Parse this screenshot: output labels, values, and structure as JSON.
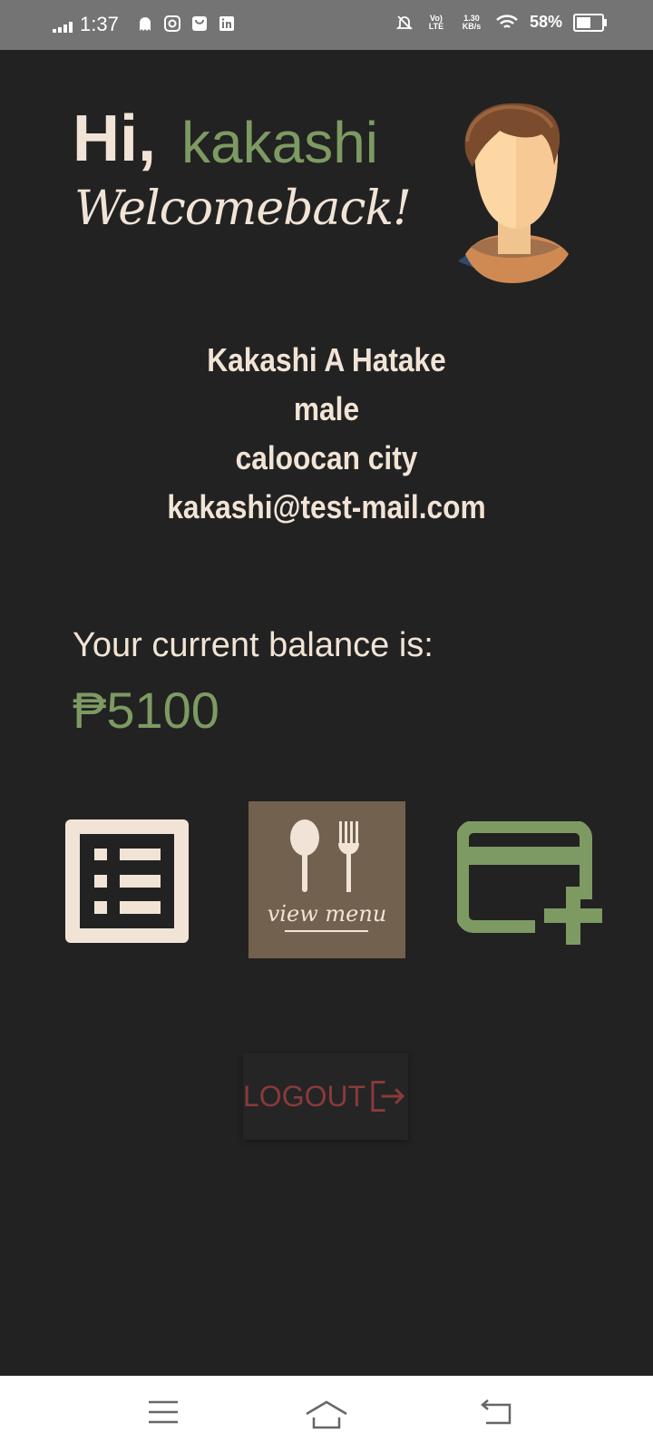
{
  "status": {
    "time": "1:37",
    "volte": "Vo) LTE",
    "speed": "1.30 KB/s",
    "battery_text": "58%",
    "battery_level": 0.58,
    "notification_icons": [
      "ghost-icon",
      "instagram-icon",
      "bag-icon",
      "linkedin-icon"
    ]
  },
  "greeting": {
    "hi": "Hi,",
    "name": "kakashi",
    "welcome": "Welcomeback!"
  },
  "profile": {
    "name": "Kakashi A Hatake",
    "gender": "male",
    "city": "caloocan city",
    "email": "kakashi@test-mail.com"
  },
  "balance": {
    "label": "Your current balance is:",
    "value": "₱5100"
  },
  "actions": {
    "menu_caption": "view menu"
  },
  "logout": {
    "label": "LOGOUT"
  },
  "colors": {
    "background": "#222222",
    "accent_green": "#7d9a63",
    "cream": "#f1e4d6",
    "logout_red": "#8a3a3a",
    "menu_brown": "#73614f"
  }
}
